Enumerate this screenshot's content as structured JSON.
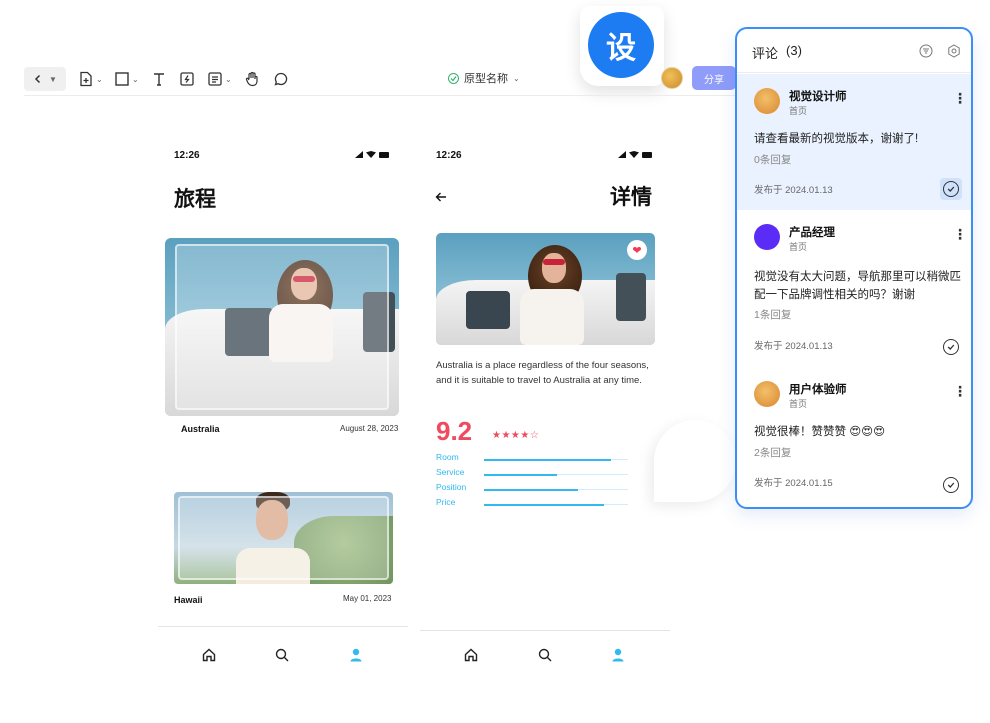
{
  "toolbar": {
    "project_name": "原型名称",
    "share_label": "分享",
    "tools": [
      "back-icon",
      "add-page-icon",
      "rectangle-icon",
      "text-icon",
      "component-icon",
      "note-icon",
      "hand-icon",
      "comment-icon"
    ]
  },
  "logo": {
    "char": "设"
  },
  "screen_list": {
    "time": "12:26",
    "title": "旅程",
    "cards": [
      {
        "place": "Australia",
        "date": "August 28, 2023"
      },
      {
        "place": "Hawaii",
        "date": "May 01, 2023"
      }
    ]
  },
  "screen_detail": {
    "time": "12:26",
    "title": "详情",
    "description": "Australia is a place regardless of the four seasons, and it is suitable to travel to Australia at any time.",
    "score": "9.2",
    "stars": "★★★★☆",
    "ratings": [
      {
        "label": "Room",
        "value": 0.88
      },
      {
        "label": "Service",
        "value": 0.51
      },
      {
        "label": "Position",
        "value": 0.65
      },
      {
        "label": "Price",
        "value": 0.83
      }
    ]
  },
  "comments_panel": {
    "title": "评论",
    "count": "(3)",
    "comments": [
      {
        "author": "视觉设计师",
        "page": "首页",
        "text": "请查看最新的视觉版本，谢谢了!",
        "replies": "0条回复",
        "date": "发布于 2024.01.13",
        "avatar_color": "#f0a650"
      },
      {
        "author": "产品经理",
        "page": "首页",
        "text": "视觉没有太大问题，导航那里可以稍微匹配一下品牌调性相关的吗？谢谢",
        "replies": "1条回复",
        "date": "发布于 2024.01.13",
        "avatar_color": "#5b2cf6"
      },
      {
        "author": "用户体验师",
        "page": "首页",
        "text": "视觉很棒！赞赞赞 😍😍😍",
        "replies": "2条回复",
        "date": "发布于 2024.01.15",
        "avatar_color": "#f0a650"
      }
    ]
  },
  "colors": {
    "accent": "#1d7cf2",
    "share": "#8f9cf9",
    "rating": "#ef4a5f",
    "bars": "#33b9ee",
    "panel_border": "#3b8ef5"
  }
}
